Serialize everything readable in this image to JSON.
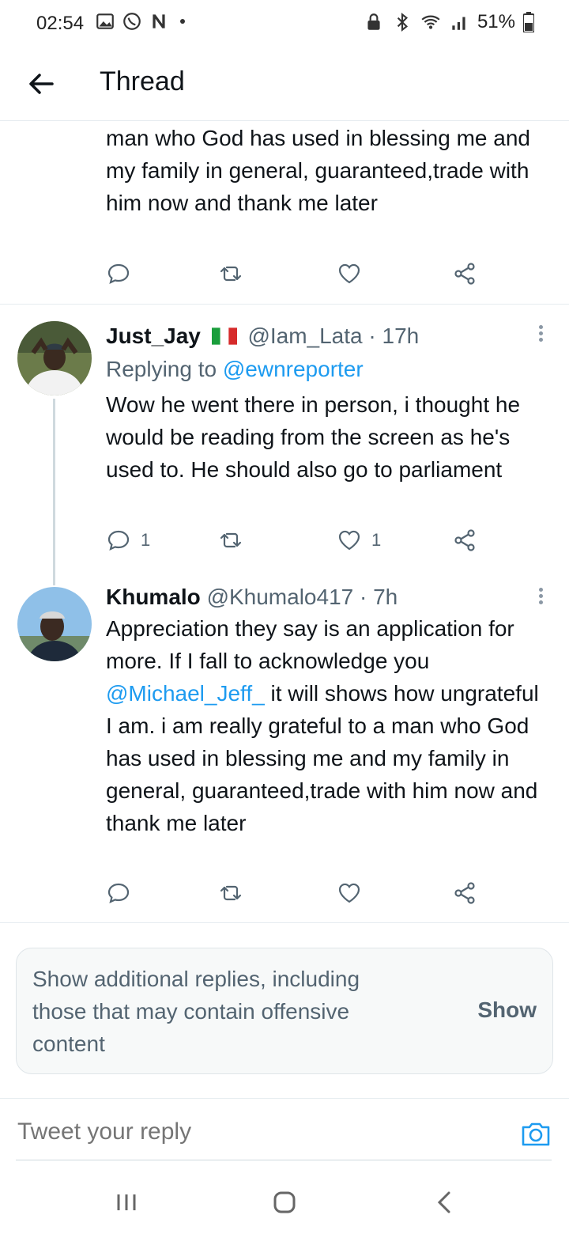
{
  "status_bar": {
    "time": "02:54",
    "battery": "51%",
    "left_icons": [
      "gallery-icon",
      "whatsapp-icon",
      "n-app-icon",
      "dot"
    ],
    "right_icons": [
      "lock-icon",
      "bluetooth-icon",
      "wifi-icon",
      "signal-icon",
      "battery-icon"
    ]
  },
  "header": {
    "title": "Thread"
  },
  "top_snippet": {
    "text": "man who God has used in blessing me and my family in general, guaranteed,trade with him now and thank me later"
  },
  "tweets": [
    {
      "name": "Just_Jay",
      "flag": "Italy",
      "handle": "@Iam_Lata",
      "time": "17h",
      "replying_prefix": "Replying to ",
      "replying_to": "@ewnreporter",
      "text": "Wow he went there in person, i thought he would be reading from the screen as he's used to. He should also go to parliament",
      "reply_count": "1",
      "like_count": "1"
    },
    {
      "name": "Khumalo",
      "handle": "@Khumalo417",
      "time": "7h",
      "text_before_mention": "Appreciation they say is an application for more. If I fall to acknowledge you ",
      "mention": "@Michael_Jeff_",
      "text_after_mention": " it will shows how ungrateful I am. i am really grateful to a man who God has used in blessing me and my family in general, guaranteed,trade with him now and thank me later"
    }
  ],
  "additional_replies": {
    "text": "Show additional replies, including those that may contain offensive content",
    "button": "Show"
  },
  "reply_bar": {
    "placeholder": "Tweet your reply"
  },
  "colors": {
    "accent": "#1d9bf0",
    "muted": "#536471",
    "text": "#0f1419"
  }
}
